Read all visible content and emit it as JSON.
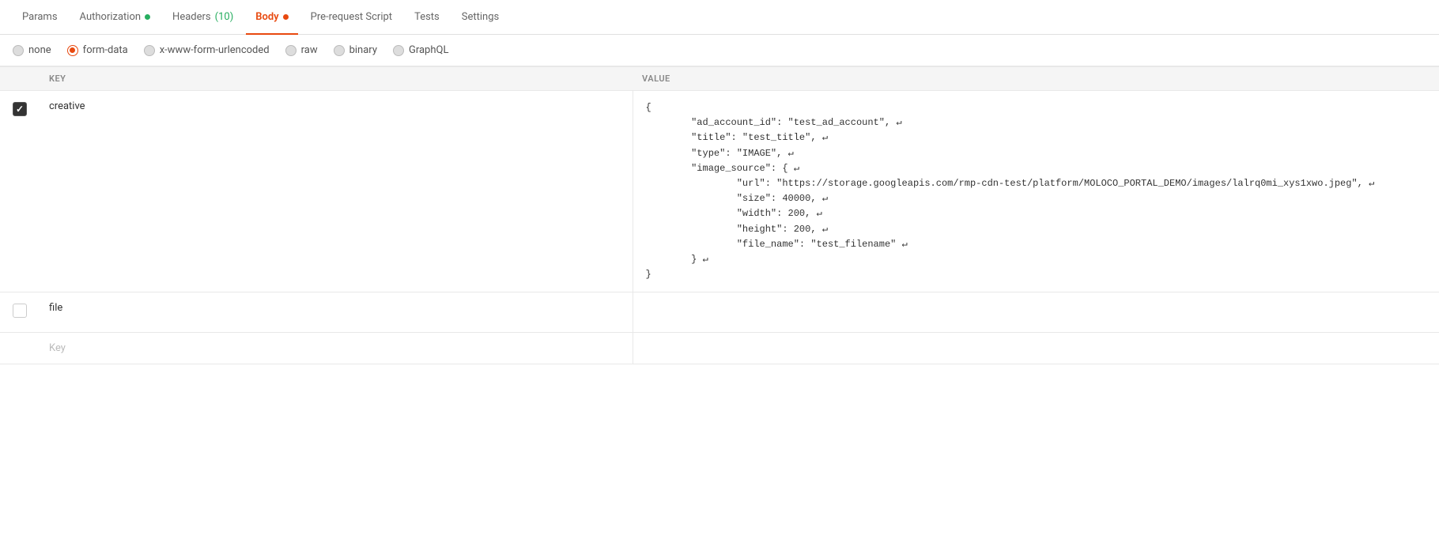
{
  "tabs": [
    {
      "id": "params",
      "label": "Params",
      "active": false,
      "dot": null,
      "badge": null
    },
    {
      "id": "authorization",
      "label": "Authorization",
      "active": false,
      "dot": "green",
      "badge": null
    },
    {
      "id": "headers",
      "label": "Headers",
      "active": false,
      "dot": null,
      "badge": "(10)",
      "badgeColor": "green"
    },
    {
      "id": "body",
      "label": "Body",
      "active": true,
      "dot": "orange",
      "badge": null
    },
    {
      "id": "pre-request",
      "label": "Pre-request Script",
      "active": false,
      "dot": null,
      "badge": null
    },
    {
      "id": "tests",
      "label": "Tests",
      "active": false,
      "dot": null,
      "badge": null
    },
    {
      "id": "settings",
      "label": "Settings",
      "active": false,
      "dot": null,
      "badge": null
    }
  ],
  "bodyTypes": [
    {
      "id": "none",
      "label": "none",
      "selected": false,
      "style": "unselected"
    },
    {
      "id": "form-data",
      "label": "form-data",
      "selected": true,
      "style": "selected"
    },
    {
      "id": "x-www-form-urlencoded",
      "label": "x-www-form-urlencoded",
      "selected": false,
      "style": "unselected"
    },
    {
      "id": "raw",
      "label": "raw",
      "selected": false,
      "style": "unselected"
    },
    {
      "id": "binary",
      "label": "binary",
      "selected": false,
      "style": "unselected"
    },
    {
      "id": "graphql",
      "label": "GraphQL",
      "selected": false,
      "style": "unselected"
    }
  ],
  "table": {
    "headers": [
      {
        "id": "spacer",
        "label": ""
      },
      {
        "id": "key",
        "label": "KEY"
      },
      {
        "id": "value",
        "label": "VALUE"
      }
    ],
    "rows": [
      {
        "id": "row-creative",
        "checked": true,
        "key": "creative",
        "value": "{\n        \"ad_account_id\": \"test_ad_account\", ↵\n        \"title\": \"test_title\", ↵\n        \"type\": \"IMAGE\", ↵\n        \"image_source\": { ↵\n                \"url\": \"https://storage.googleapis.com/rmp-cdn-test/platform/MOLOCO_PORTAL_DEMO/images/lalrq0mi_xys1xwo.jpeg\", ↵\n                \"size\": 40000, ↵\n                \"width\": 200, ↵\n                \"height\": 200, ↵\n                \"file_name\": \"test_filename\" ↵\n        } ↵\n}"
      },
      {
        "id": "row-file",
        "checked": false,
        "key": "file",
        "value": ""
      },
      {
        "id": "row-empty",
        "checked": null,
        "key": "Key",
        "value": "",
        "placeholder": true
      }
    ]
  }
}
